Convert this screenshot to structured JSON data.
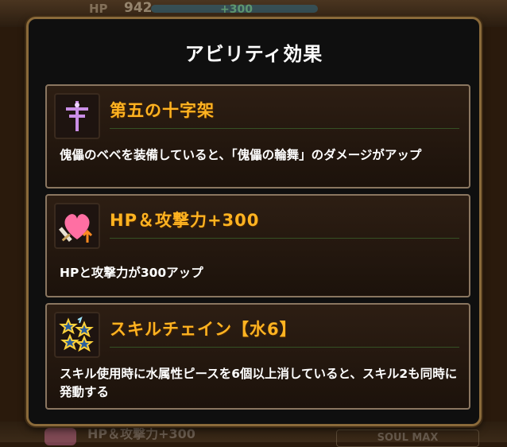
{
  "background": {
    "hp_label": "HP",
    "hp_value": "942",
    "hp_bonus": "+300",
    "bottom_text": "HP＆攻撃力+300",
    "soul_max": "SOUL MAX"
  },
  "modal": {
    "title": "アビリティ効果",
    "abilities": [
      {
        "icon": "cross-icon",
        "title": "第五の十字架",
        "description": "傀儡のベベを装備していると、「傀儡の輪舞」のダメージがアップ"
      },
      {
        "icon": "heart-sword-icon",
        "title": "HP＆攻撃力+300",
        "description": "HPと攻撃力が300アップ"
      },
      {
        "icon": "stars-icon",
        "title": "スキルチェイン【水6】",
        "description": "スキル使用時に水属性ピースを6個以上消していると、スキル2も同時に発動する"
      }
    ]
  },
  "colors": {
    "accent_title": "#ffb321",
    "modal_border": "#8a6a3a",
    "card_border": "#8a7660"
  }
}
